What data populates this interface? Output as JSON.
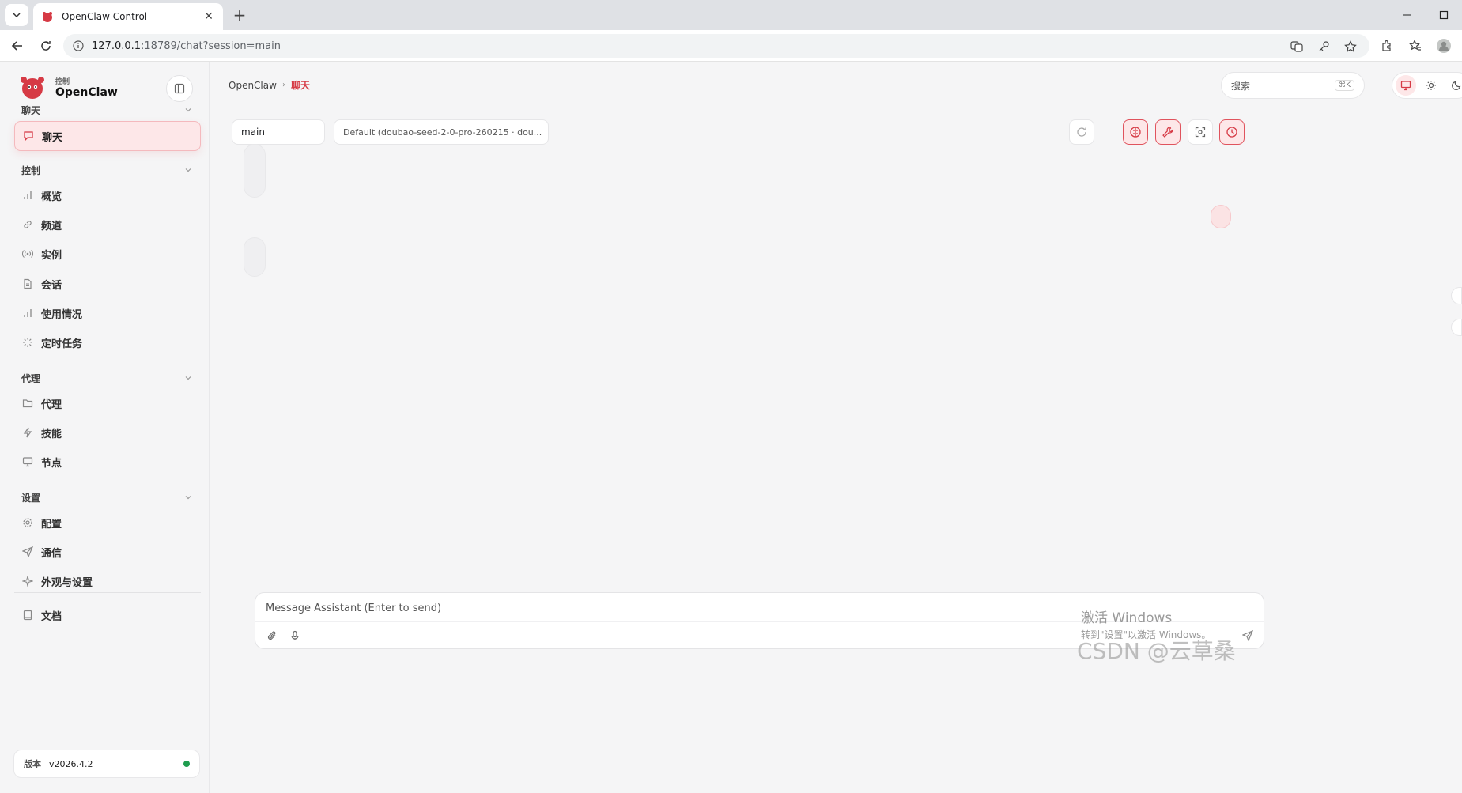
{
  "browser": {
    "tab_title": "OpenClaw Control",
    "url_host": "127.0.0.1",
    "url_rest": ":18789/chat?session=main",
    "new_tab": "+",
    "close": "✕"
  },
  "brand": {
    "subtitle": "控制",
    "title": "OpenClaw"
  },
  "sidebar": {
    "sections": [
      {
        "label": "聊天",
        "items": [
          {
            "label": "聊天",
            "icon": "message-icon",
            "active": true
          }
        ]
      },
      {
        "label": "控制",
        "items": [
          {
            "label": "概览",
            "icon": "bar-chart-icon"
          },
          {
            "label": "频道",
            "icon": "link-icon"
          },
          {
            "label": "实例",
            "icon": "broadcast-icon"
          },
          {
            "label": "会话",
            "icon": "file-icon"
          },
          {
            "label": "使用情况",
            "icon": "bar-chart-icon"
          },
          {
            "label": "定时任务",
            "icon": "loader-icon"
          }
        ]
      },
      {
        "label": "代理",
        "items": [
          {
            "label": "代理",
            "icon": "folder-icon"
          },
          {
            "label": "技能",
            "icon": "zap-icon"
          },
          {
            "label": "节点",
            "icon": "monitor-icon"
          }
        ]
      },
      {
        "label": "设置",
        "items": [
          {
            "label": "配置",
            "icon": "gear-icon"
          },
          {
            "label": "通信",
            "icon": "send-icon"
          },
          {
            "label": "外观与设置",
            "icon": "sparkle-icon"
          }
        ]
      }
    ],
    "docs": "文档",
    "version_label": "版本",
    "version_value": "v2026.4.2",
    "status_color": "#1f9d4f"
  },
  "topbar": {
    "breadcrumb_root": "OpenClaw",
    "breadcrumb_sep": "›",
    "breadcrumb_current": "聊天",
    "search_placeholder": "搜索",
    "search_shortcut": "⌘K"
  },
  "chat": {
    "session": "main",
    "model": "Default (doubao-seed-2-0-pro-260215 · dou...",
    "composer_placeholder": "Message Assistant (Enter to send)"
  },
  "watermark": {
    "line1": "激活 Windows",
    "line2": "转到\"设置\"以激活 Windows。",
    "csdn": "CSDN @云草桑"
  },
  "colors": {
    "accent": "#d63a45",
    "active_bg": "#fde7e8"
  }
}
